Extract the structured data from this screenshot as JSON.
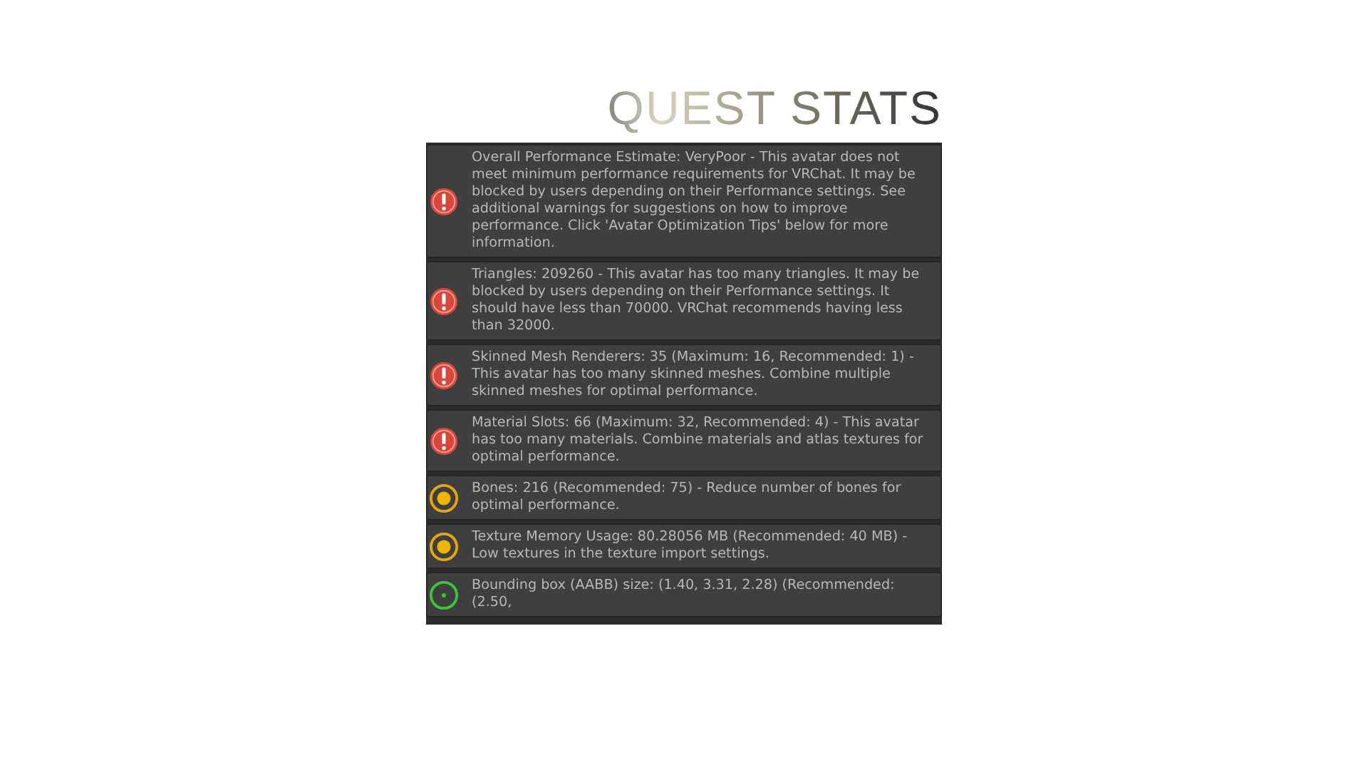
{
  "title": "QUEST STATS",
  "messages": [
    {
      "kind": "error",
      "text": "Overall Performance Estimate: VeryPoor - This avatar does not meet minimum performance requirements for VRChat. It may be blocked by users depending on their Performance settings. See additional warnings for suggestions on how to improve performance. Click 'Avatar Optimization Tips' below for more information."
    },
    {
      "kind": "error",
      "text": "Triangles: 209260 - This avatar has too many triangles. It may be blocked by users depending on their Performance settings. It should have less than 70000. VRChat recommends having less than 32000."
    },
    {
      "kind": "error",
      "text": "Skinned Mesh Renderers: 35 (Maximum: 16, Recommended: 1) - This avatar has too many skinned meshes. Combine multiple skinned meshes for optimal performance."
    },
    {
      "kind": "error",
      "text": "Material Slots: 66 (Maximum: 32, Recommended: 4) - This avatar has too many materials. Combine materials and atlas textures for optimal performance."
    },
    {
      "kind": "warning",
      "text": "Bones: 216 (Recommended: 75) - Reduce number of bones for optimal performance."
    },
    {
      "kind": "warning",
      "text": "Texture Memory Usage: 80.28056 MB (Recommended: 40 MB) - Low textures in the texture import settings."
    },
    {
      "kind": "ok",
      "text": "Bounding box (AABB) size: (1.40, 3.31, 2.28) (Recommended: (2.50,"
    }
  ]
}
